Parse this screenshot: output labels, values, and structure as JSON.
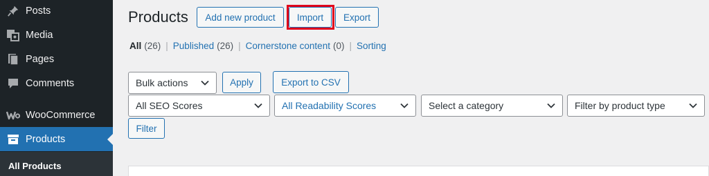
{
  "sidebar": {
    "items": [
      {
        "label": "Posts",
        "icon": "pin-icon"
      },
      {
        "label": "Media",
        "icon": "media-icon"
      },
      {
        "label": "Pages",
        "icon": "pages-icon"
      },
      {
        "label": "Comments",
        "icon": "comment-icon"
      },
      {
        "label": "WooCommerce",
        "icon": "woocommerce-icon"
      },
      {
        "label": "Products",
        "icon": "archive-icon",
        "active": true
      }
    ],
    "submenu": {
      "label": "All Products"
    }
  },
  "header": {
    "title": "Products",
    "add_new_label": "Add new product",
    "import_label": "Import",
    "export_label": "Export"
  },
  "views": {
    "all_label": "All",
    "all_count": "(26)",
    "published_label": "Published",
    "published_count": "(26)",
    "cornerstone_label": "Cornerstone content",
    "cornerstone_count": "(0)",
    "sorting_label": "Sorting",
    "separator": "|"
  },
  "actions": {
    "bulk_actions": "Bulk actions",
    "apply_label": "Apply",
    "export_csv_label": "Export to CSV"
  },
  "filters": {
    "seo": "All SEO Scores",
    "readability": "All Readability Scores",
    "category": "Select a category",
    "product_type": "Filter by product type",
    "filter_label": "Filter"
  },
  "colors": {
    "sidebar_bg": "#1d2327",
    "accent": "#2271b1",
    "highlight": "#e0001b",
    "page_bg": "#f0f0f1"
  }
}
